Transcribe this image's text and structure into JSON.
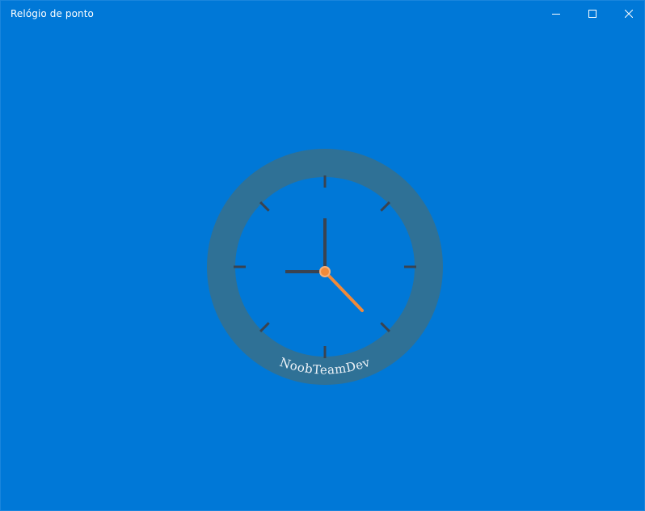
{
  "window": {
    "title": "Relógio de ponto",
    "controls": {
      "minimize": "minimize-icon",
      "maximize": "maximize-icon",
      "close": "close-icon"
    }
  },
  "clock": {
    "brand": "NoobTeamDev",
    "time": {
      "hours": 9,
      "minutes": 23
    },
    "colors": {
      "background": "#0078D7",
      "bezel": "#2F7196",
      "face": "#0078D7",
      "ticks": "#3A4350",
      "hands": "#3A4350",
      "minute_hand": "#F08A3A",
      "center": "#F08A3A"
    }
  }
}
